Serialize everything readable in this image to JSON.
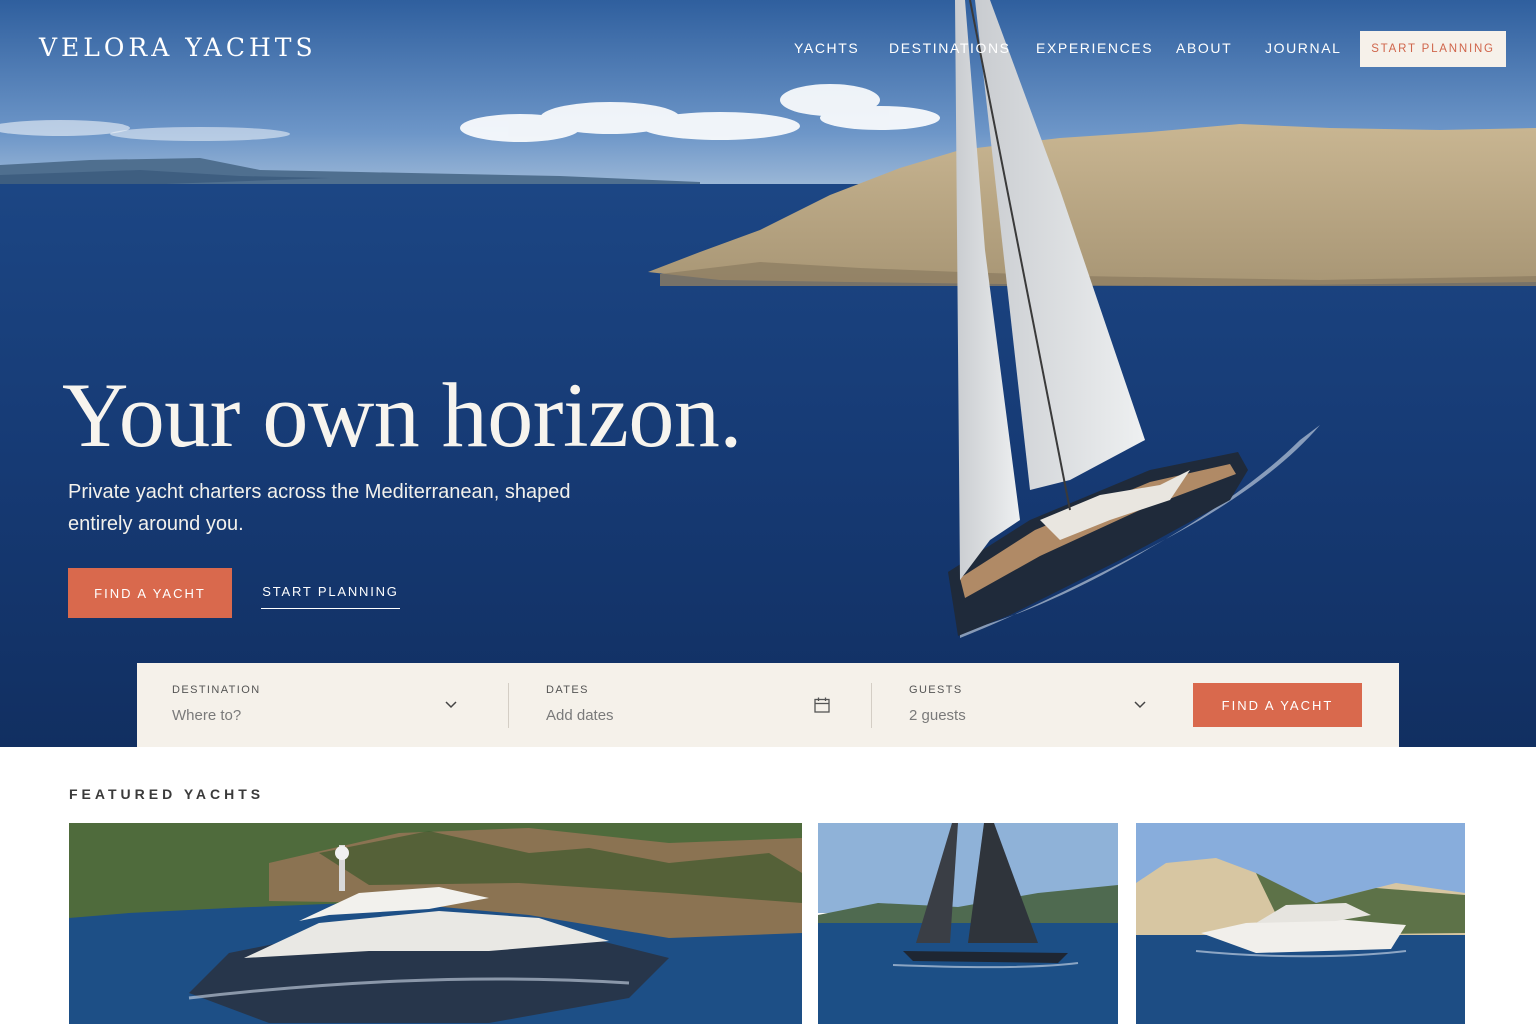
{
  "brand": {
    "name": "VELORA YACHTS"
  },
  "nav": {
    "items": [
      "YACHTS",
      "DESTINATIONS",
      "EXPERIENCES",
      "ABOUT",
      "JOURNAL"
    ],
    "cta_label": "START PLANNING"
  },
  "hero": {
    "title": "Your own horizon.",
    "subtitle": "Private yacht charters across the Mediterranean, shaped entirely around you.",
    "primary_cta": "FIND A YACHT",
    "secondary_cta": "START PLANNING"
  },
  "search": {
    "destination": {
      "label": "DESTINATION",
      "placeholder": "Where to?",
      "icon": "chevron-down-icon"
    },
    "dates": {
      "label": "DATES",
      "placeholder": "Add dates",
      "icon": "calendar-icon"
    },
    "guests": {
      "label": "GUESTS",
      "value": "2 guests",
      "icon": "chevron-down-icon"
    },
    "button_label": "FIND A YACHT"
  },
  "featured": {
    "heading": "FEATURED YACHTS"
  },
  "colors": {
    "accent": "#d9694d",
    "search_bg": "#f5f1ea",
    "sea": "#173c78",
    "sky": "#3f6fae"
  }
}
